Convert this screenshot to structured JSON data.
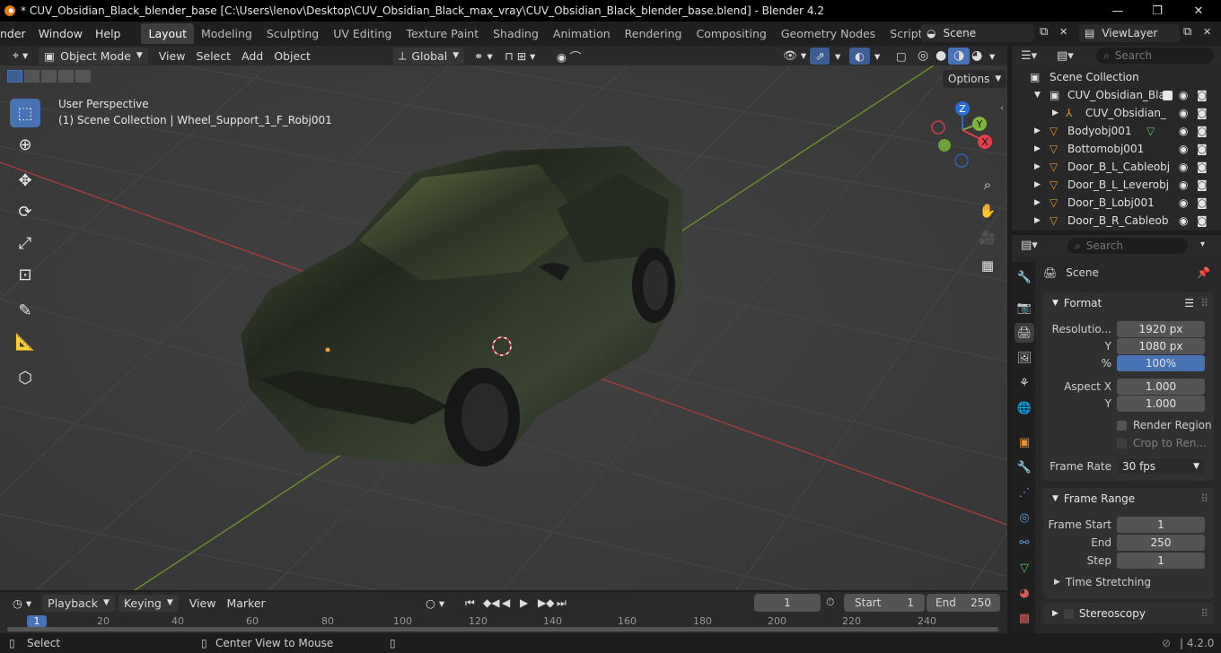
{
  "titlebar": {
    "title": "* CUV_Obsidian_Black_blender_base [C:\\Users\\lenov\\Desktop\\CUV_Obsidian_Black_max_vray\\CUV_Obsidian_Black_blender_base.blend] - Blender 4.2",
    "minimize": "—",
    "maximize": "❐",
    "close": "✕"
  },
  "menus": [
    "nder",
    "Window",
    "Help"
  ],
  "workspaces": [
    "Layout",
    "Modeling",
    "Sculpting",
    "UV Editing",
    "Texture Paint",
    "Shading",
    "Animation",
    "Rendering",
    "Compositing",
    "Geometry Nodes",
    "Scripting"
  ],
  "active_workspace": "Layout",
  "scene": {
    "name": "Scene",
    "viewlayer": "ViewLayer"
  },
  "viewport_header": {
    "mode": "Object Mode",
    "menus": [
      "View",
      "Select",
      "Add",
      "Object"
    ],
    "orientation": "Global",
    "options": "Options"
  },
  "viewport": {
    "perspective": "User Perspective",
    "collection_info": "(1) Scene Collection | Wheel_Support_1_F_Robj001",
    "gizmo": {
      "z": "Z",
      "y": "Y",
      "x": "X"
    }
  },
  "outliner": {
    "search_placeholder": "Search",
    "root": "Scene Collection",
    "items": [
      {
        "name": "CUV_Obsidian_Blac",
        "indent": 1
      },
      {
        "name": "CUV_Obsidian_",
        "indent": 2
      },
      {
        "name": "Bodyobj001",
        "indent": 1
      },
      {
        "name": "Bottomobj001",
        "indent": 1
      },
      {
        "name": "Door_B_L_Cableobj",
        "indent": 1
      },
      {
        "name": "Door_B_L_Leverobj",
        "indent": 1
      },
      {
        "name": "Door_B_Lobj001",
        "indent": 1
      },
      {
        "name": "Door_B_R_Cableob",
        "indent": 1
      }
    ]
  },
  "properties": {
    "search_placeholder": "Search",
    "context": "Scene",
    "format": {
      "title": "Format",
      "res_label": "Resolutio...",
      "res_x": "1920 px",
      "y_label": "Y",
      "res_y": "1080 px",
      "pct_label": "%",
      "pct": "100%",
      "aspect_label": "Aspect X",
      "aspect_x": "1.000",
      "aspect_y_label": "Y",
      "aspect_y": "1.000",
      "render_region": "Render Region",
      "crop": "Crop to Ren...",
      "frame_rate_label": "Frame Rate",
      "frame_rate": "30 fps"
    },
    "frame_range": {
      "title": "Frame Range",
      "start_label": "Frame Start",
      "start": "1",
      "end_label": "End",
      "end": "250",
      "step_label": "Step",
      "step": "1",
      "time_stretching": "Time Stretching"
    },
    "stereoscopy": "Stereoscopy"
  },
  "timeline": {
    "menus": [
      "Playback",
      "Keying",
      "View",
      "Marker"
    ],
    "current_frame": "1",
    "start_label": "Start",
    "start": "1",
    "end_label": "End",
    "end": "250",
    "ticks": [
      "1",
      "20",
      "40",
      "60",
      "80",
      "100",
      "120",
      "140",
      "160",
      "180",
      "200",
      "220",
      "240"
    ]
  },
  "status": {
    "select": "Select",
    "center_view": "Center View to Mouse",
    "version": "4.2.0"
  }
}
